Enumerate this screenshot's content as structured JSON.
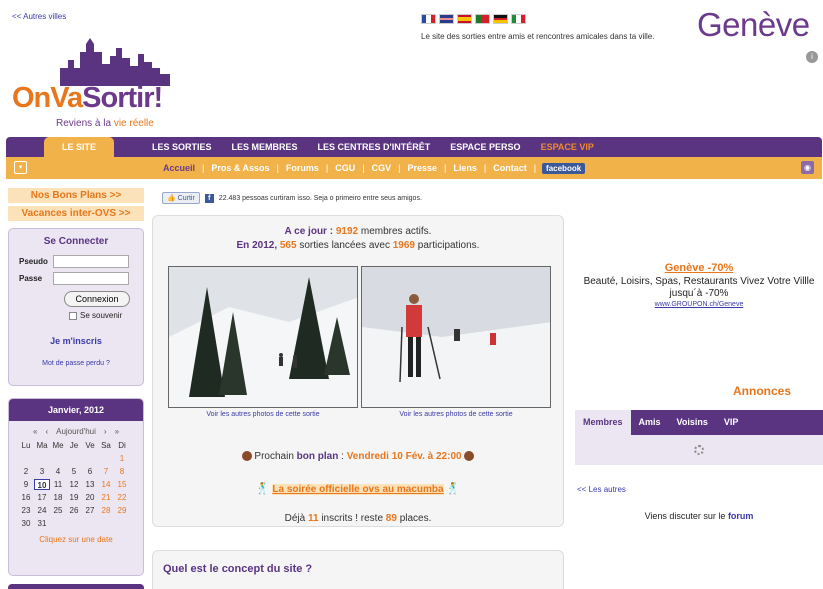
{
  "header": {
    "other_cities": "<< Autres villes",
    "tagline": "Le site des sorties entre amis et rencontres amicales dans ta ville.",
    "city": "Genève",
    "logo_main_a": "OnVa",
    "logo_main_b": "Sortir!",
    "slogan_a": "Reviens à la ",
    "slogan_b": "vie réelle"
  },
  "nav_primary": [
    "LE SITE",
    "LES SORTIES",
    "LES MEMBRES",
    "LES CENTRES D'INTÉRÊT",
    "ESPACE PERSO",
    "ESPACE VIP"
  ],
  "nav_secondary": [
    "Accueil",
    "Pros & Assos",
    "Forums",
    "CGU",
    "CGV",
    "Presse",
    "Liens",
    "Contact"
  ],
  "facebook_label": "facebook",
  "promos": {
    "bons_plans": "Nos Bons Plans >>",
    "vacances": "Vacances inter-OVS >>"
  },
  "login": {
    "title": "Se Connecter",
    "pseudo_label": "Pseudo",
    "passe_label": "Passe",
    "button": "Connexion",
    "remember": "Se souvenir",
    "signup": "Je m'inscris",
    "forgot": "Mot de passe perdu ?"
  },
  "calendar": {
    "title": "Janvier, 2012",
    "nav": [
      "«",
      "‹",
      "Aujourd'hui",
      "›",
      "»"
    ],
    "days": [
      "Lu",
      "Ma",
      "Me",
      "Je",
      "Ve",
      "Sa",
      "Di"
    ],
    "weeks": [
      [
        "",
        "",
        "",
        "",
        "",
        "",
        "1"
      ],
      [
        "2",
        "3",
        "4",
        "5",
        "6",
        "7",
        "8"
      ],
      [
        "9",
        "10",
        "11",
        "12",
        "13",
        "14",
        "15"
      ],
      [
        "16",
        "17",
        "18",
        "19",
        "20",
        "21",
        "22"
      ],
      [
        "23",
        "24",
        "25",
        "26",
        "27",
        "28",
        "29"
      ],
      [
        "30",
        "31",
        "",
        "",
        "",
        "",
        ""
      ]
    ],
    "today": "10",
    "link": "Cliquez sur une date"
  },
  "social": {
    "like_button": "Curtir",
    "like_text": "22.483 pessoas curtiram isso. Seja o primeiro entre seus amigos."
  },
  "stats": {
    "line1_prefix": "A ce jour : ",
    "members": "9192",
    "line1_suffix": " membres actifs.",
    "line2_prefix": "En 2012, ",
    "outings": "565",
    "line2_mid": " sorties lancées avec ",
    "participations": "1969",
    "line2_suffix": " participations."
  },
  "photos": {
    "caption1": "Voir les autres photos de cette sortie",
    "caption2": "Voir les autres photos de cette sortie"
  },
  "plan": {
    "prefix": " Prochain ",
    "bold": "bon plan",
    "sep": " : ",
    "date": "Vendredi 10 Fév. à 22:00",
    "event": "La soirée officielle ovs au macumba",
    "places_prefix": "Déjà ",
    "inscrits": "11",
    "places_mid": " inscrits ! reste ",
    "remaining": "89",
    "places_suffix": " places."
  },
  "concept_title": "Quel est le concept du site ?",
  "ad": {
    "title": "Genève -70%",
    "desc": "Beauté, Loisirs, Spas, Restaurants Vivez Votre Villle jusqu´à -70%",
    "url": "www.GROUPON.ch/Geneve"
  },
  "annonces": "Annonces",
  "member_tabs": [
    "Membres",
    "Amis",
    "Voisins",
    "VIP"
  ],
  "others_link": "<< Les autres",
  "forum": {
    "prefix": "Viens discuter sur le ",
    "link": "forum"
  },
  "colors": {
    "purple": "#5a3480",
    "orange": "#e8761c",
    "nav_orange": "#f2b24a"
  }
}
